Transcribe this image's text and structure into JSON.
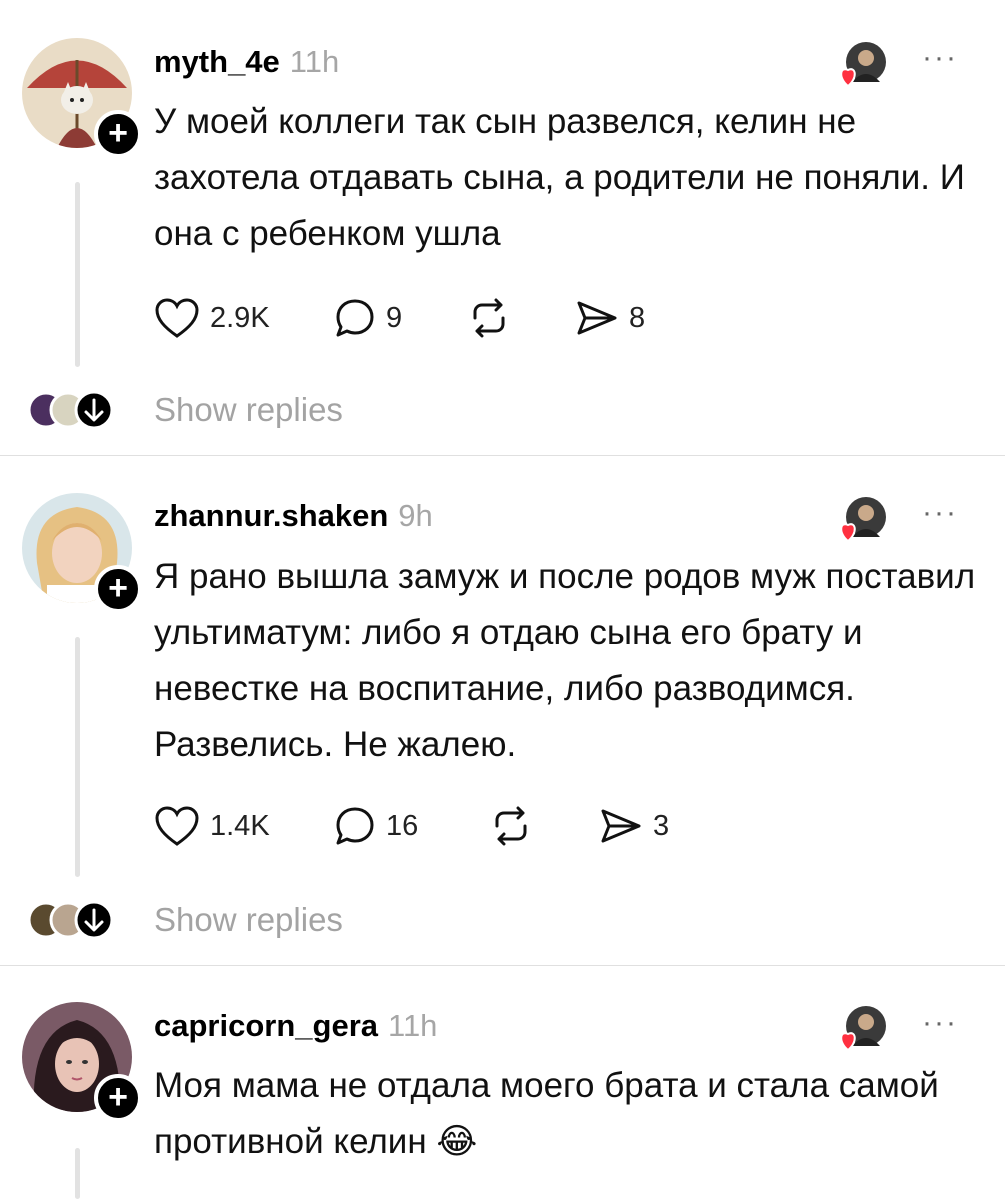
{
  "posts": [
    {
      "username": "myth_4e",
      "time": "11h",
      "text": "У моей коллеги так сын развелся, келин не захотела отдавать сына, а родители не поняли. И она с ребенком ушла",
      "likes": "2.9K",
      "comments": "9",
      "shares": "8",
      "show_replies": "Show replies"
    },
    {
      "username": "zhannur.shaken",
      "time": "9h",
      "text": "Я рано вышла замуж и после родов муж поставил ультиматум: либо я отдаю сына его брату и невестке на воспитание, либо разводимся. Развелись. Не жалею.",
      "likes": "1.4K",
      "comments": "16",
      "shares": "3",
      "show_replies": "Show replies"
    },
    {
      "username": "capricorn_gera",
      "time": "11h",
      "text": "Моя мама не отдала моего брата и стала самой противной келин 😂"
    }
  ],
  "icons": {
    "like": "heart-icon",
    "comment": "comment-icon",
    "repost": "repost-icon",
    "share": "share-icon",
    "more": "more-icon",
    "follow": "plus-icon",
    "expand": "arrow-down-icon"
  },
  "colors": {
    "heart_badge": "#ff3040",
    "meta_gray": "#a6a6a6"
  }
}
